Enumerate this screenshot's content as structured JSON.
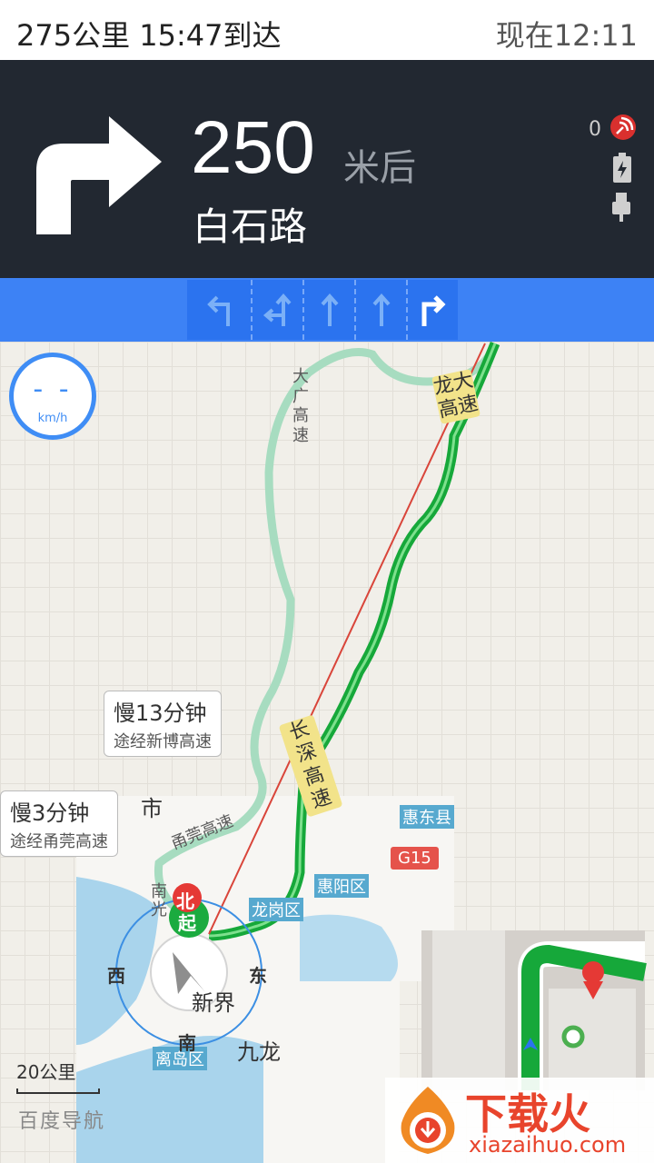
{
  "status": {
    "trip": "275公里  15:47到达",
    "now": "现在12:11"
  },
  "nav": {
    "distance": "250",
    "unit": "米后",
    "road": "白石路",
    "signal_count": "0",
    "icons": [
      "turn-right-icon",
      "satellite-signal-icon",
      "battery-charging-icon",
      "usb-icon"
    ]
  },
  "lanes": [
    {
      "icon": "lane-turn-left-icon"
    },
    {
      "icon": "lane-left-straight-icon"
    },
    {
      "icon": "lane-straight-icon"
    },
    {
      "icon": "lane-straight-icon"
    },
    {
      "icon": "lane-turn-right-icon",
      "active": true
    }
  ],
  "speed": {
    "value": "- -",
    "unit": "km/h"
  },
  "tips": [
    {
      "main": "慢13分钟",
      "sub": "途经新博高速"
    },
    {
      "main": "慢3分钟",
      "sub": "途经甬莞高速"
    }
  ],
  "roads": {
    "longda": "龙大高速",
    "changshen": "长深高速",
    "dada": "大广高速",
    "yongguan": "甬莞高速",
    "nanguang": "南光"
  },
  "places": {
    "huidong": "惠东县",
    "g15": "G15",
    "huiyang": "惠阳区",
    "longgang": "龙岗区",
    "xinjie": "新界",
    "jiulong": "九龙",
    "lidao": "离岛区",
    "shi": "市"
  },
  "compass": {
    "north": "北",
    "south": "南",
    "east": "东",
    "west": "西",
    "start": "起"
  },
  "scale": "20公里",
  "brand": "百度导航",
  "watermark": {
    "title": "下载火",
    "site": "xiazaihuo.com"
  },
  "colors": {
    "route_smooth": "#16a83a",
    "route_alt": "#a7dcc0",
    "nav_bg": "#222831",
    "lane_bar": "#3d82f5"
  }
}
